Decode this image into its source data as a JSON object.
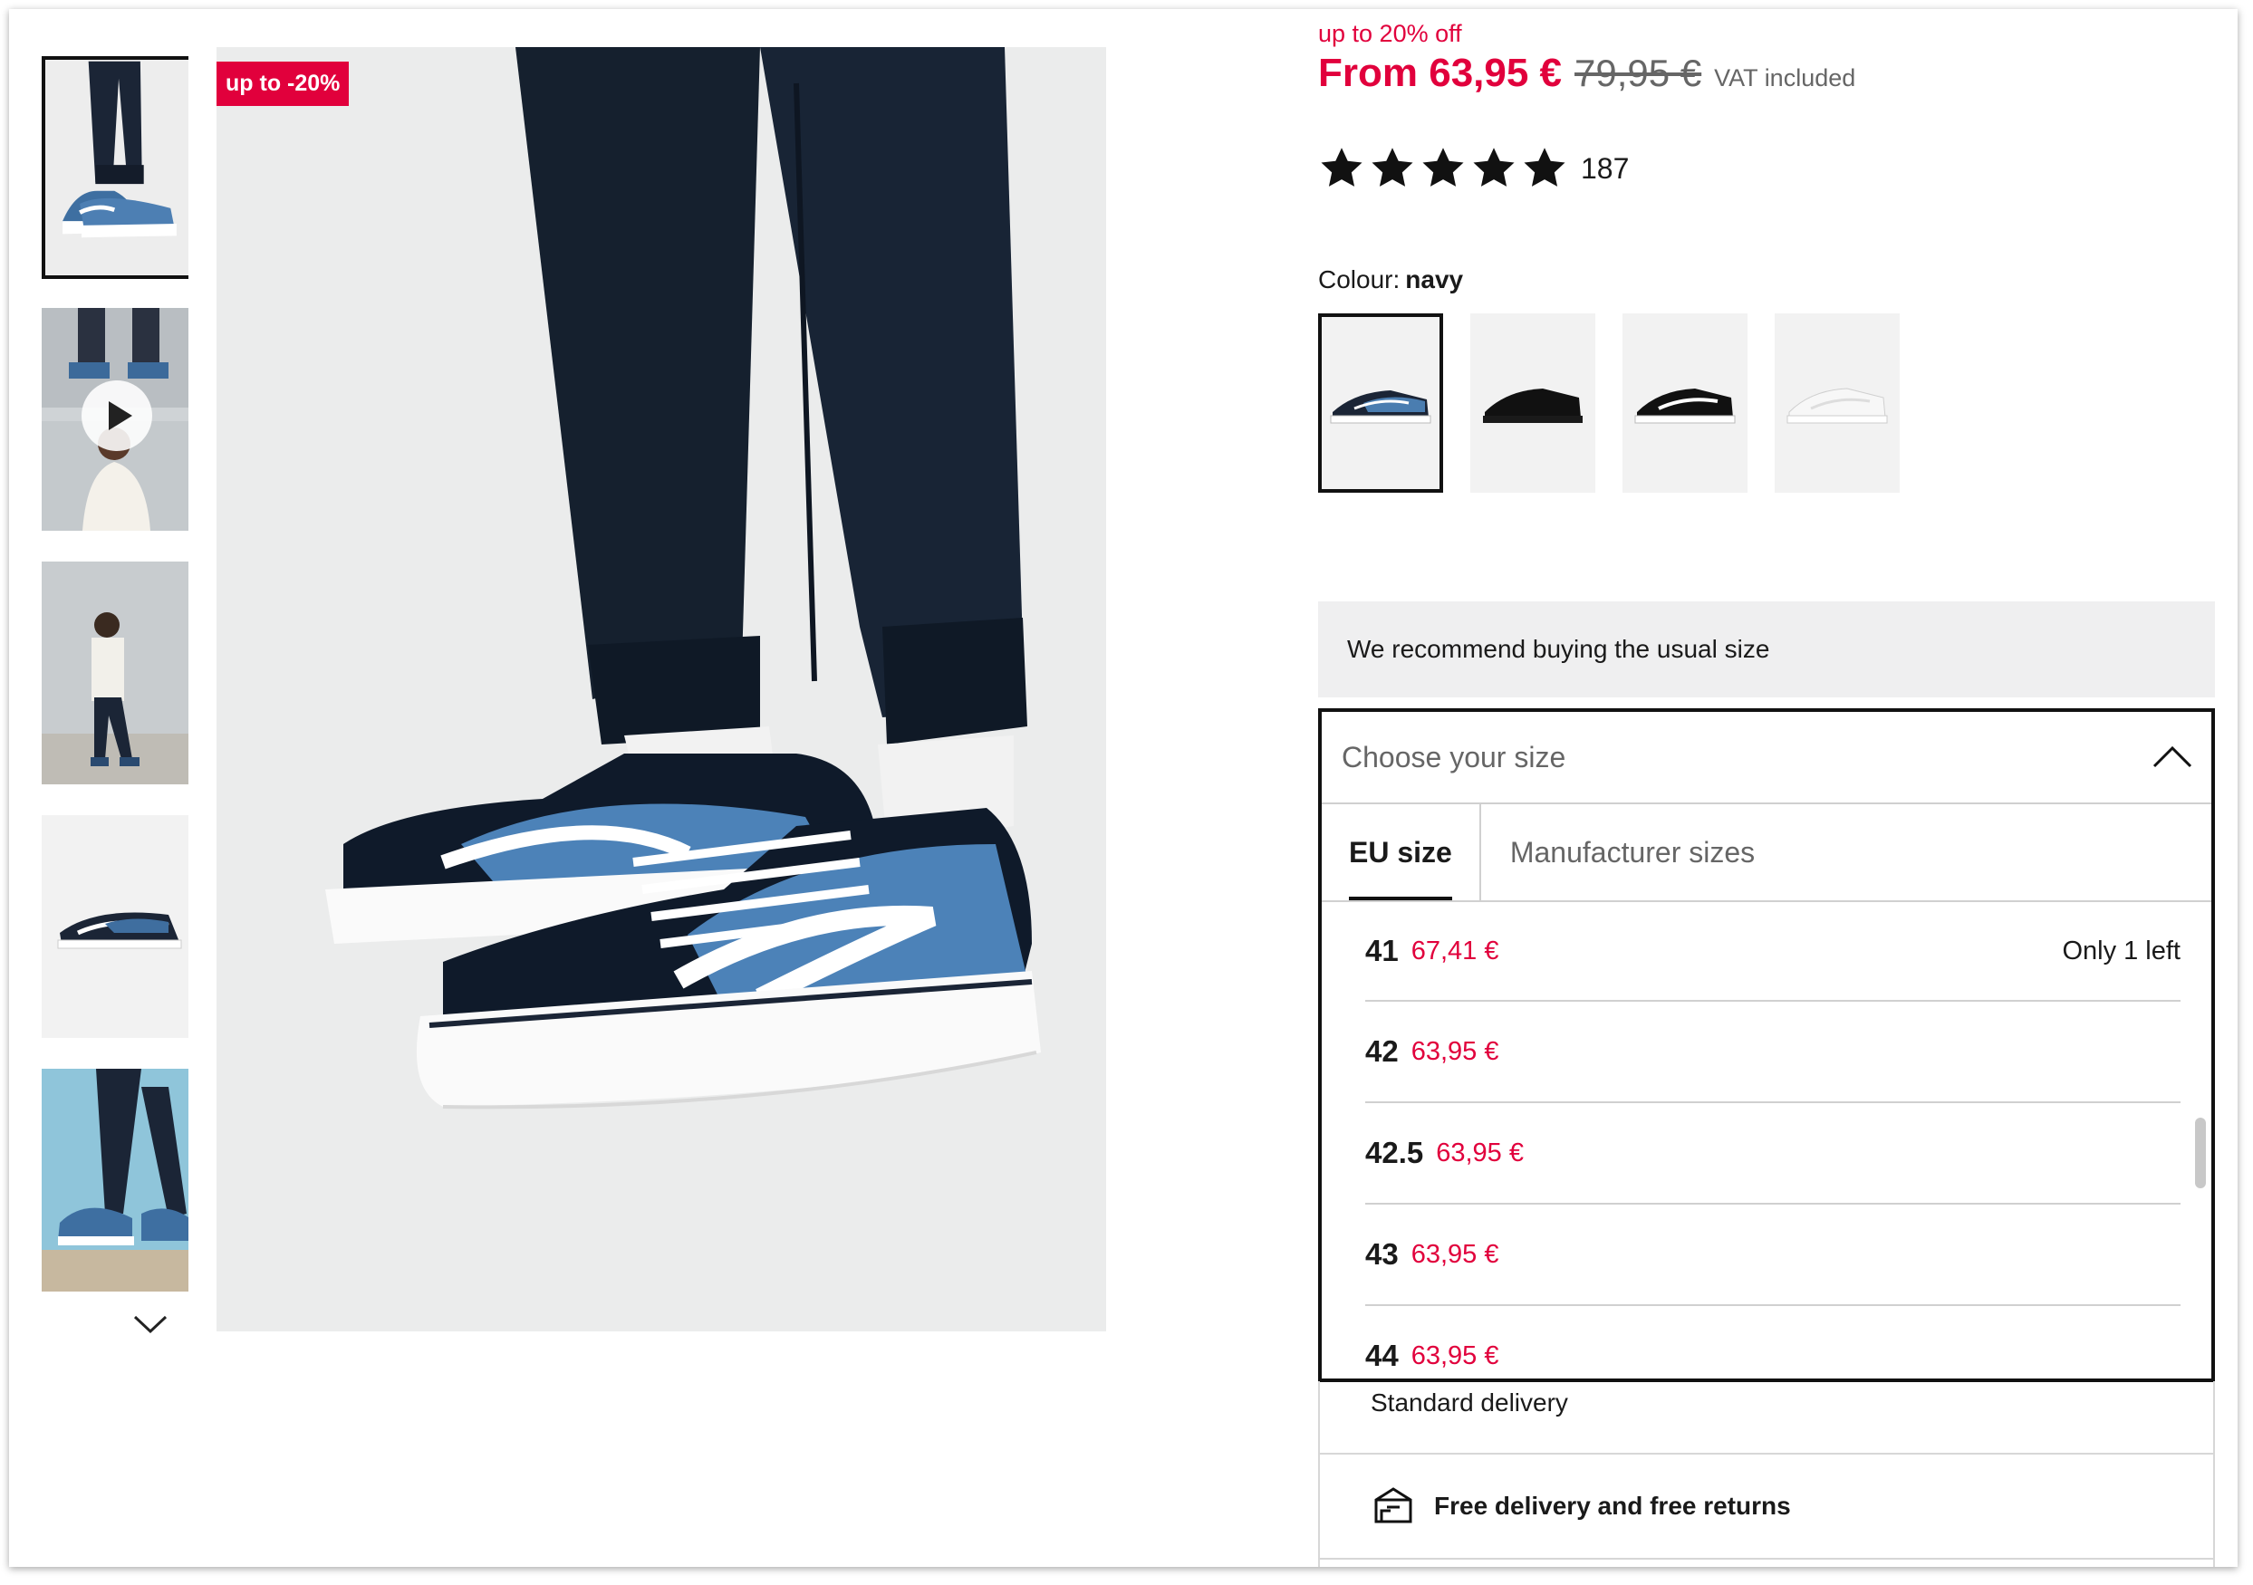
{
  "gallery": {
    "sale_badge": "up to -20%",
    "thumbnails": [
      {
        "name": "navy sneaker side view",
        "selected": true
      },
      {
        "name": "video preview",
        "video": true
      },
      {
        "name": "model full body"
      },
      {
        "name": "shoe product shot"
      },
      {
        "name": "walking shot"
      }
    ]
  },
  "price": {
    "discount_label": "up to 20% off",
    "current": "From 63,95 €",
    "original": "79,95 €",
    "vat": "VAT included"
  },
  "rating": {
    "stars": 5,
    "count": "187"
  },
  "colour": {
    "label": "Colour:",
    "value": "navy",
    "options": [
      "navy",
      "black/black",
      "black/white",
      "white"
    ]
  },
  "recommendation": "We recommend buying the usual size",
  "size_picker": {
    "placeholder": "Choose your size",
    "tabs": [
      "EU size",
      "Manufacturer sizes"
    ],
    "sizes": [
      {
        "size": "41",
        "price": "67,41 €",
        "stock": "Only 1 left"
      },
      {
        "size": "42",
        "price": "63,95 €",
        "stock": ""
      },
      {
        "size": "42.5",
        "price": "63,95 €",
        "stock": ""
      },
      {
        "size": "43",
        "price": "63,95 €",
        "stock": ""
      },
      {
        "size": "44",
        "price": "63,95 €",
        "stock": ""
      }
    ]
  },
  "delivery": {
    "standard": "Standard delivery",
    "free": "Free delivery and free returns"
  },
  "colors": {
    "sale": "#e1003c",
    "text": "#1a1a1a",
    "muted": "#666666"
  }
}
